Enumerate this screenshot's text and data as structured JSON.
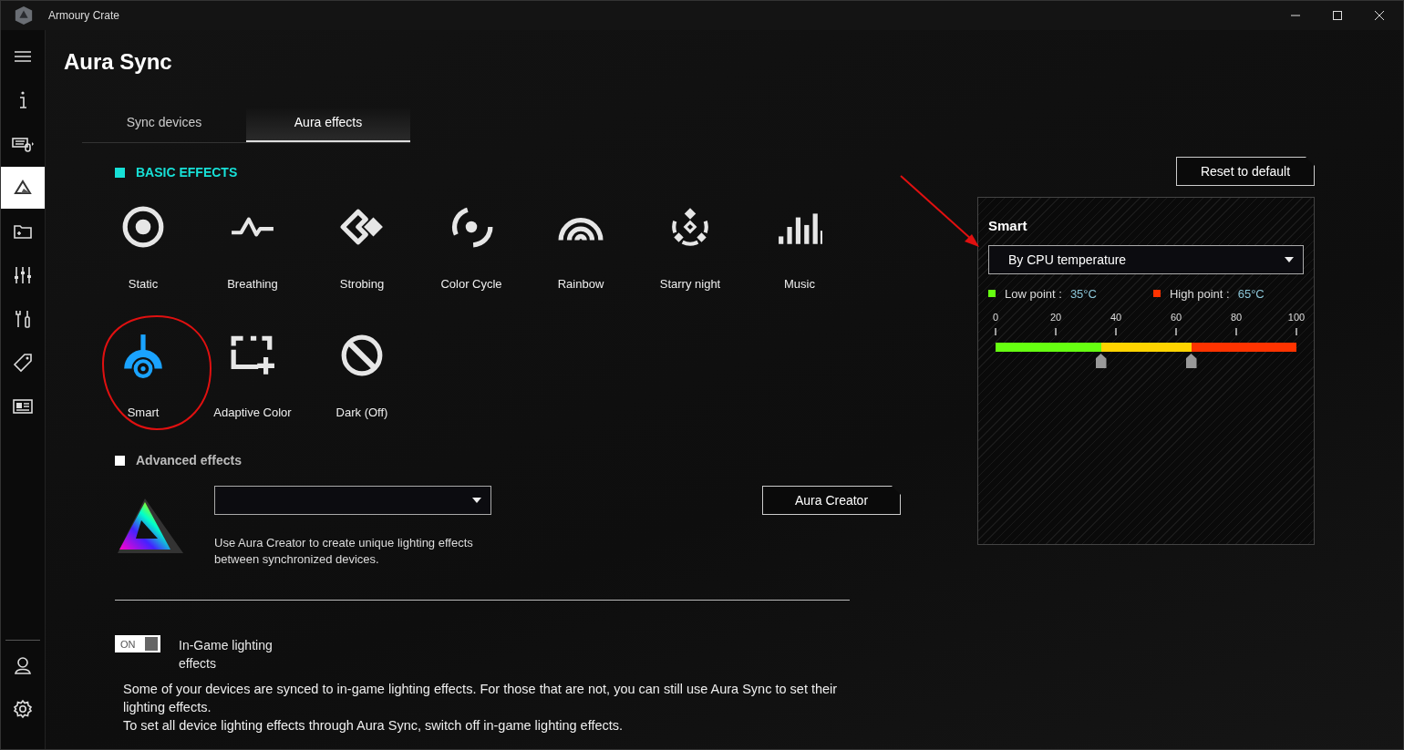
{
  "window": {
    "title": "Armoury Crate"
  },
  "sidebar": {
    "items": [
      {
        "kind": "menu",
        "selected": false
      },
      {
        "kind": "info",
        "selected": false
      },
      {
        "kind": "devices",
        "selected": false
      },
      {
        "kind": "aura",
        "selected": true
      },
      {
        "kind": "games",
        "selected": false
      },
      {
        "kind": "mixer",
        "selected": false
      },
      {
        "kind": "tools",
        "selected": false
      },
      {
        "kind": "deals",
        "selected": false
      },
      {
        "kind": "news",
        "selected": false
      }
    ],
    "bottom_items": [
      {
        "kind": "user",
        "selected": false
      },
      {
        "kind": "settings",
        "selected": false
      }
    ]
  },
  "page": {
    "title": "Aura Sync"
  },
  "tabs": [
    {
      "label": "Sync devices",
      "selected": false
    },
    {
      "label": "Aura effects",
      "selected": true
    }
  ],
  "basic_effects": {
    "title": "BASIC EFFECTS",
    "selected": true,
    "effects": [
      {
        "kind": "static",
        "label": "Static",
        "selected": false
      },
      {
        "kind": "breathing",
        "label": "Breathing",
        "selected": false
      },
      {
        "kind": "strobing",
        "label": "Strobing",
        "selected": false
      },
      {
        "kind": "colorcycle",
        "label": "Color Cycle",
        "selected": false
      },
      {
        "kind": "rainbow",
        "label": "Rainbow",
        "selected": false
      },
      {
        "kind": "starry",
        "label": "Starry night",
        "selected": false
      },
      {
        "kind": "music",
        "label": "Music",
        "selected": false
      },
      {
        "kind": "smart",
        "label": "Smart",
        "selected": true
      },
      {
        "kind": "adaptive",
        "label": "Adaptive Color",
        "selected": false
      },
      {
        "kind": "dark",
        "label": "Dark (Off)",
        "selected": false
      }
    ]
  },
  "advanced_effects": {
    "title": "Advanced effects",
    "selected": false,
    "description": "Use Aura Creator to create unique lighting effects between synchronized devices.",
    "button": "Aura Creator"
  },
  "in_game": {
    "toggle": {
      "label": "ON",
      "on": true
    },
    "label": "In-Game lighting effects",
    "notes": [
      "Some of your devices are synced to in-game lighting effects. For those that are not, you can still use Aura Sync to set their lighting effects.",
      "To set all device lighting effects through Aura Sync, switch off in-game lighting effects."
    ]
  },
  "reset_button": "Reset to default",
  "smart_panel": {
    "title": "Smart",
    "source": "By CPU temperature",
    "low": {
      "label": "Low point :",
      "value": "35°C",
      "color": "#66ff11",
      "level": 0.35
    },
    "high": {
      "label": "High point :",
      "value": "65°C",
      "color": "#ff3300",
      "level": 0.65
    },
    "scale": [
      "0",
      "20",
      "40",
      "60",
      "80",
      "100"
    ]
  }
}
